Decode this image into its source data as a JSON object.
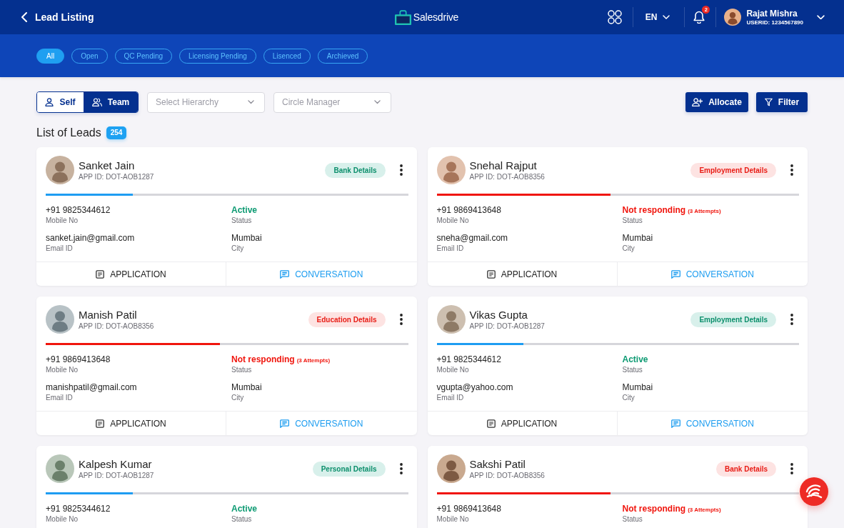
{
  "header": {
    "back_label": "Lead Listing",
    "brand": "Salesdrive",
    "language": "EN",
    "notification_count": "2",
    "user": {
      "name": "Rajat Mishra",
      "user_id": "USERID: 1234567890"
    }
  },
  "filters": [
    {
      "label": "All",
      "selected": true
    },
    {
      "label": "Open",
      "selected": false
    },
    {
      "label": "QC Pending",
      "selected": false
    },
    {
      "label": "Licensing Pending",
      "selected": false
    },
    {
      "label": "Lisenced",
      "selected": false
    },
    {
      "label": "Archieved",
      "selected": false
    }
  ],
  "toolbar": {
    "scope": [
      {
        "label": "Self",
        "kind": "self",
        "selected": false
      },
      {
        "label": "Team",
        "kind": "team",
        "selected": true
      }
    ],
    "dropdowns": [
      {
        "placeholder": "Select Hierarchy"
      },
      {
        "placeholder": "Circle Manager"
      }
    ],
    "buttons": [
      {
        "label": "Allocate",
        "kind": "allocate"
      },
      {
        "label": "Filter",
        "kind": "filter"
      }
    ]
  },
  "list": {
    "title": "List of Leads",
    "count": "254"
  },
  "leads": [
    {
      "name": "Sanket Jain",
      "app_id": "APP ID: DOT-AOB1287",
      "tag": "Bank Details",
      "kind": "active",
      "level": 0.24,
      "fields": [
        {
          "kind": "text",
          "value": "+91 9825344612",
          "label": "Mobile No"
        },
        {
          "kind": "status",
          "value": "Active",
          "label": "Status"
        },
        {
          "kind": "text",
          "value": "sanket.jain@gmail.com",
          "label": "Email ID"
        },
        {
          "kind": "text",
          "value": "Mumbai",
          "label": "City"
        }
      ],
      "actions": [
        {
          "kind": "application",
          "label": "APPLICATION"
        },
        {
          "kind": "conversation",
          "label": "CONVERSATION"
        }
      ]
    },
    {
      "name": "Snehal Rajput",
      "app_id": "APP ID: DOT-AOB8356",
      "tag": "Employment Details",
      "kind": "not_responding",
      "level": 0.48,
      "fields": [
        {
          "kind": "text",
          "value": "+91 9869413648",
          "label": "Mobile No"
        },
        {
          "kind": "status",
          "value": "Not responding",
          "note": "(3 Attempts)",
          "label": "Status"
        },
        {
          "kind": "text",
          "value": "sneha@gmail.com",
          "label": "Email ID"
        },
        {
          "kind": "text",
          "value": "Mumbai",
          "label": "City"
        }
      ],
      "actions": [
        {
          "kind": "application",
          "label": "APPLICATION"
        },
        {
          "kind": "conversation",
          "label": "CONVERSATION"
        }
      ]
    },
    {
      "name": "Manish Patil",
      "app_id": "APP ID: DOT-AOB8356",
      "tag": "Education Details",
      "kind": "not_responding",
      "level": 0.48,
      "fields": [
        {
          "kind": "text",
          "value": "+91 9869413648",
          "label": "Mobile No"
        },
        {
          "kind": "status",
          "value": "Not responding",
          "note": "(3 Attempts)",
          "label": "Status"
        },
        {
          "kind": "text",
          "value": "manishpatil@gmail.com",
          "label": "Email ID"
        },
        {
          "kind": "text",
          "value": "Mumbai",
          "label": "City"
        }
      ],
      "actions": [
        {
          "kind": "application",
          "label": "APPLICATION"
        },
        {
          "kind": "conversation",
          "label": "CONVERSATION"
        }
      ]
    },
    {
      "name": "Vikas Gupta",
      "app_id": "APP ID: DOT-AOB1287",
      "tag": "Employment Details",
      "kind": "active",
      "level": 0.24,
      "fields": [
        {
          "kind": "text",
          "value": "+91 9825344612",
          "label": "Mobile No"
        },
        {
          "kind": "status",
          "value": "Active",
          "label": "Status"
        },
        {
          "kind": "text",
          "value": "vgupta@yahoo.com",
          "label": "Email ID"
        },
        {
          "kind": "text",
          "value": "Mumbai",
          "label": "City"
        }
      ],
      "actions": [
        {
          "kind": "application",
          "label": "APPLICATION"
        },
        {
          "kind": "conversation",
          "label": "CONVERSATION"
        }
      ]
    },
    {
      "name": "Kalpesh Kumar",
      "app_id": "APP ID: DOT-AOB1287",
      "tag": "Personal Details",
      "kind": "active",
      "level": 0.24,
      "fields": [
        {
          "kind": "text",
          "value": "+91 9825344612",
          "label": "Mobile No"
        },
        {
          "kind": "status",
          "value": "Active",
          "label": "Status"
        }
      ]
    },
    {
      "name": "Sakshi Patil",
      "app_id": "APP ID: DOT-AOB8356",
      "tag": "Bank Details",
      "kind": "not_responding",
      "level": 0.48,
      "fields": [
        {
          "kind": "text",
          "value": "+91 9869413648",
          "label": "Mobile No"
        },
        {
          "kind": "status",
          "value": "Not responding",
          "note": "(3 Attempts)",
          "label": "Status"
        }
      ]
    }
  ]
}
